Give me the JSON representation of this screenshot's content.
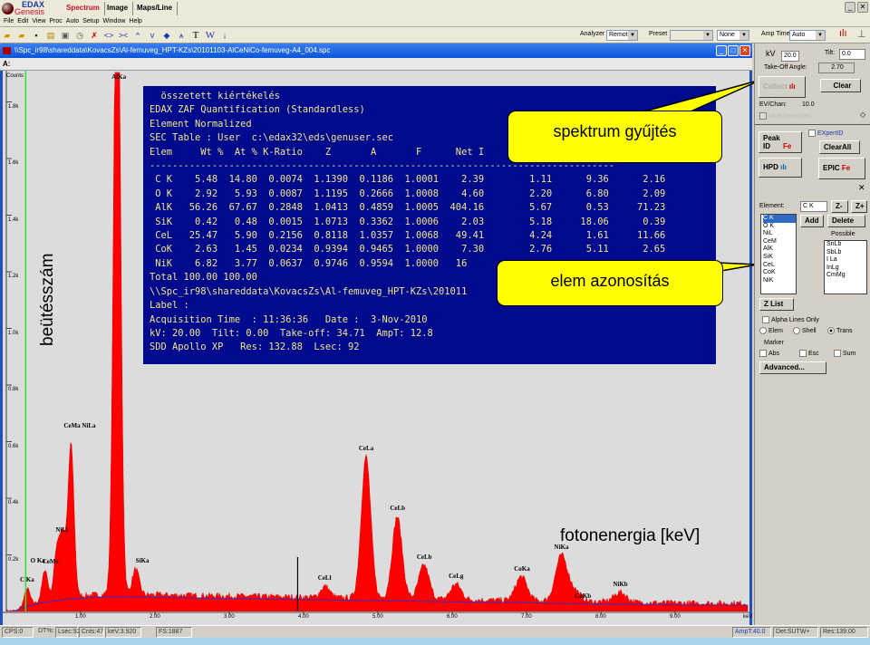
{
  "app": {
    "logo_top": "EDAX",
    "logo_bottom": "Genesis",
    "tabs": [
      "Spectrum",
      "Image",
      "Maps/Line"
    ],
    "active_tab": "Spectrum"
  },
  "menu": [
    "File",
    "Edit",
    "View",
    "Proc",
    "Auto",
    "Setup",
    "Window",
    "Help"
  ],
  "toolbar": {
    "analyzer_label": "Analyzer",
    "analyzer_value": "Remote",
    "preset_label": "Preset",
    "preset_value": "",
    "preset_mode": "None",
    "amp_time_label": "Amp Time",
    "amp_time_value": "Auto",
    "text_tool": "T",
    "w_tool": "W"
  },
  "window": {
    "title": "\\\\Spc_ir98\\shareddata\\KovacsZs\\Al-femuveg_HPT-KZs\\20101103-AlCeNiCo-femuveg-A4_004.spc",
    "sub_label": "A:"
  },
  "results": {
    "lines_top": [
      "  összetett kiértékelés",
      "EDAX ZAF Quantification (Standardless)",
      "Element Normalized",
      "SEC Table : User  c:\\edax32\\eds\\genuser.sec"
    ],
    "header": "Elem     Wt %  At % K-Ratio    Z       A       F      Net I",
    "separator": "----------------------------------------------------------------------------------",
    "rows": [
      " C K    5.48  14.80  0.0074  1.1390  0.1186  1.0001    2.39        1.11      9.36      2.16",
      " O K    2.92   5.93  0.0087  1.1195  0.2666  1.0008    4.60        2.20      6.80      2.09",
      " AlK   56.26  67.67  0.2848  1.0413  0.4859  1.0005  404.16        5.67      0.53     71.23",
      " SiK    0.42   0.48  0.0015  1.0713  0.3362  1.0006    2.03        5.18     18.06      0.39",
      " CeL   25.47   5.90  0.2156  0.8118  1.0357  1.0068   49.41        4.24      1.61     11.66",
      " CoK    2.63   1.45  0.0234  0.9394  0.9465  1.0000    7.30        2.76      5.11      2.65",
      " NiK    6.82   3.77  0.0637  0.9746  0.9594  1.0000   16"
    ],
    "lines_bottom": [
      "Total 100.00 100.00",
      "\\\\Spc_ir98\\shareddata\\KovacsZs\\Al-femuveg_HPT-KZs\\201011",
      "Label :",
      "Acquisition Time  : 11:36:36   Date :  3-Nov-2010",
      "kV: 20.00  Tilt: 0.00  Take-off: 34.71  AmpT: 12.8",
      "SDD Apollo XP   Res: 132.88  Lsec: 92"
    ]
  },
  "annotations": {
    "collect": "spektrum gyűjtés",
    "identify": "elem azonosítás",
    "y_axis": "beütésszám",
    "x_axis": "fotonenergia [keV]"
  },
  "chart_data": {
    "type": "area",
    "ylabel_unit": "Counts",
    "xunit": "keV",
    "xlim": [
      0,
      10
    ],
    "ylim": [
      0,
      1920
    ],
    "yticks": [
      "0.2k",
      "0.4k",
      "0.6k",
      "0.8k",
      "1.0k",
      "1.2k",
      "1.4k",
      "1.6k",
      "1.8k"
    ],
    "xticks": [
      "1.00",
      "2.00",
      "3.00",
      "4.00",
      "5.00",
      "6.00",
      "7.00",
      "8.00",
      "9.00"
    ],
    "fill_color": "#ff0000",
    "background_color": "#3030c0",
    "marker_keV": 3.92,
    "green_marker_keV": 0.26,
    "peaks": [
      {
        "label": "C Ka",
        "keV": 0.28,
        "counts": 60
      },
      {
        "label": "O Ka",
        "keV": 0.52,
        "counts": 110
      },
      {
        "label": "CeMz",
        "keV": 0.68,
        "counts": 170
      },
      {
        "label": "NiLl",
        "keV": 0.76,
        "counts": 210
      },
      {
        "label": "CeMa NiLa",
        "keV": 0.87,
        "counts": 540
      },
      {
        "label": "AlKa",
        "keV": 1.49,
        "counts": 2500
      },
      {
        "label": "SiKa",
        "keV": 1.74,
        "counts": 90
      },
      {
        "label": "CeLl",
        "keV": 4.29,
        "counts": 40
      },
      {
        "label": "CeLa",
        "keV": 4.84,
        "counts": 500
      },
      {
        "label": "CeLb",
        "keV": 5.26,
        "counts": 290
      },
      {
        "label": "CeLb",
        "keV": 5.62,
        "counts": 120
      },
      {
        "label": "CeLg",
        "keV": 6.05,
        "counts": 55
      },
      {
        "label": "CoKa",
        "keV": 6.93,
        "counts": 85
      },
      {
        "label": "NiKa",
        "keV": 7.47,
        "counts": 160
      },
      {
        "label": "CoKb",
        "keV": 7.65,
        "counts": 35
      },
      {
        "label": "NiKb",
        "keV": 8.26,
        "counts": 35
      }
    ]
  },
  "panel": {
    "kv_label": "kV",
    "kv": "20.0",
    "tilt_label": "Tilt:",
    "tilt": "0.0",
    "takeoff_label": "Take-Off Angle:",
    "takeoff": "2.70",
    "collect": "Collect",
    "clear": "Clear",
    "evchan_label": "EV/Chan:",
    "evchan": "10.0",
    "multi": "Multi Detectors",
    "peakid": "Peak ID",
    "expertid": "EXpertID",
    "clearall": "ClearAll",
    "hpd": "HPD",
    "epic": "EPIC",
    "element_label": "Element:",
    "element": "C K",
    "zminus": "Z-",
    "zplus": "Z+",
    "add": "Add",
    "delete": "Delete",
    "possible_label": "Possible",
    "elements": [
      "C K",
      "O K",
      "NiL",
      "CeM",
      "AlK",
      "SiK",
      "CeL",
      "CoK",
      "NiK"
    ],
    "possible": [
      "SnLb",
      "SbLb",
      "I La",
      "InLg",
      "CmMg"
    ],
    "zlist": "Z List",
    "alpha": "Alpha Lines Only",
    "elem": "Elem",
    "shell": "Shell",
    "trans": "Trans",
    "marker": "Marker",
    "abs": "Abs",
    "esc": "Esc",
    "sum": "Sum",
    "advanced": "Advanced..."
  },
  "status": {
    "cps": "CPS:0",
    "dt": "DT%:",
    "lsec": "Lsec:92",
    "cnts": "Cnts:47",
    "kev": "keV:3.920",
    "fs": "FS:1887",
    "ampt": "AmpT:40.0",
    "det": "Det:SUTW+",
    "res": "Res:139.00"
  }
}
